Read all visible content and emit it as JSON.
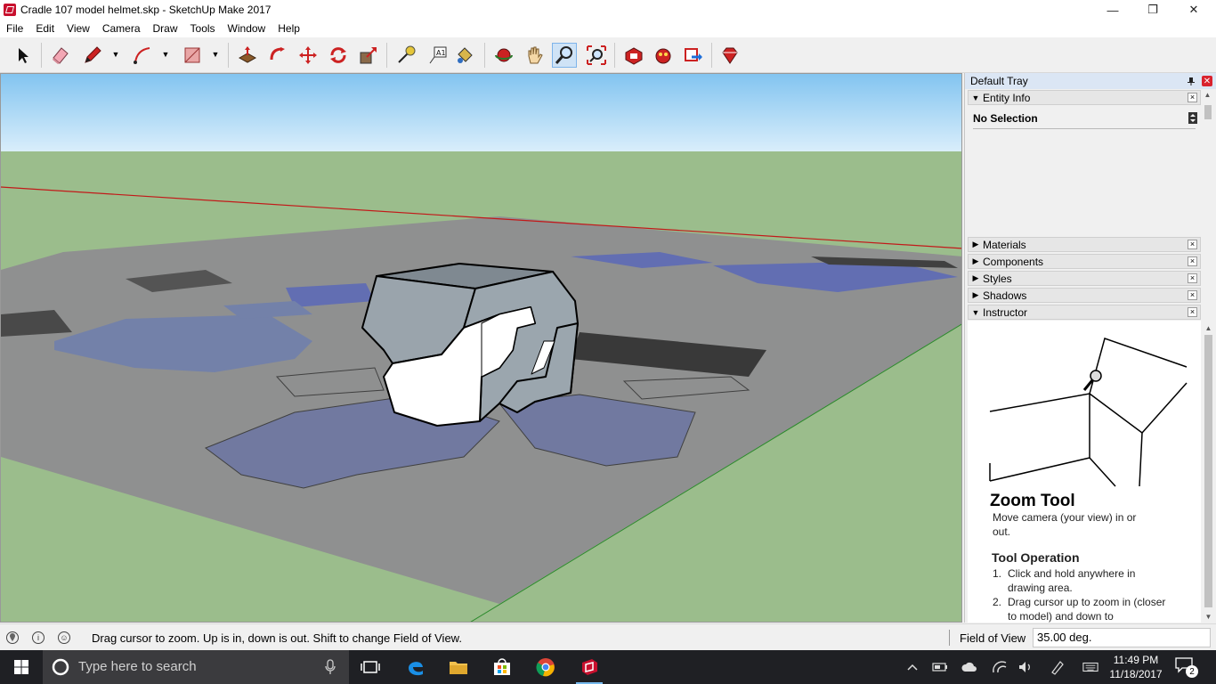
{
  "window": {
    "title": "Cradle 107 model helmet.skp - SketchUp Make 2017",
    "minimize_glyph": "—",
    "maximize_glyph": "❐",
    "close_glyph": "✕"
  },
  "menu": [
    "File",
    "Edit",
    "View",
    "Camera",
    "Draw",
    "Tools",
    "Window",
    "Help"
  ],
  "toolbar": {
    "tools": [
      "select-tool",
      "eraser-tool",
      "line-tool",
      "arc-tool",
      "rectangle-tool",
      "push-pull-tool",
      "follow-me-tool",
      "move-tool",
      "rotate-tool",
      "scale-tool",
      "tape-measure-tool",
      "text-tool",
      "paint-bucket-tool",
      "orbit-tool",
      "pan-tool",
      "zoom-tool",
      "zoom-extents-tool",
      "3d-warehouse-tool",
      "extension-warehouse-tool",
      "share-model-tool",
      "extension-manager-tool"
    ],
    "active_tool": "zoom-tool",
    "dropdown_glyph": "▼"
  },
  "tray": {
    "title": "Default Tray",
    "pin_glyph": "📌",
    "close_glyph": "✕",
    "entity_info": {
      "title": "Entity Info",
      "selection": "No Selection",
      "expanded": true
    },
    "panels": [
      {
        "title": "Materials",
        "expanded": false
      },
      {
        "title": "Components",
        "expanded": false
      },
      {
        "title": "Styles",
        "expanded": false
      },
      {
        "title": "Shadows",
        "expanded": false
      },
      {
        "title": "Instructor",
        "expanded": true
      }
    ],
    "collapsed_glyph": "▶",
    "expanded_glyph": "▼",
    "panel_close_glyph": "×",
    "instructor": {
      "tool_name": "Zoom Tool",
      "description": "Move camera (your view) in or out.",
      "section_title": "Tool Operation",
      "steps": [
        {
          "num": "1.",
          "text": "Click and hold anywhere in drawing area."
        },
        {
          "num": "2.",
          "text": "Drag cursor up to zoom in (closer to model) and down to"
        }
      ]
    }
  },
  "statusbar": {
    "message": "Drag cursor to zoom.  Up is in, down is out. Shift to change Field of View.",
    "measurement_label": "Field of View",
    "measurement_value": "35.00 deg.",
    "icon_glyphs": [
      "?",
      "i",
      "☺"
    ]
  },
  "taskbar": {
    "search_placeholder": "Type here to search",
    "apps": [
      "task-view",
      "edge",
      "file-explorer",
      "store",
      "chrome",
      "sketchup"
    ],
    "time": "11:49 PM",
    "date": "11/18/2017",
    "notification_count": "2"
  },
  "colors": {
    "sky": "#86c8f2",
    "ground": "#9bbd8c",
    "paper": "#8f9090",
    "helmet": "#9ba6ae",
    "accent": "#c8102e"
  }
}
